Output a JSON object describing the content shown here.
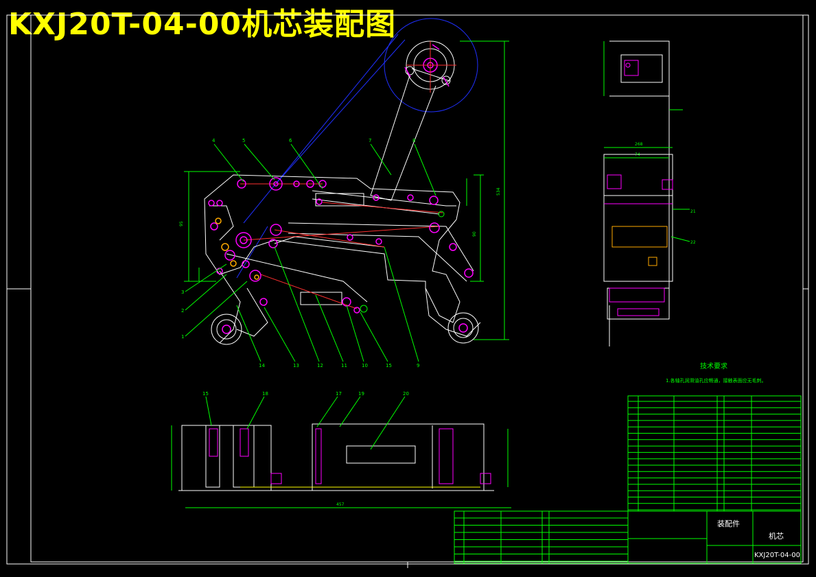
{
  "title": "KXJ20T-04-00机芯装配图",
  "colors": {
    "background": "#000000",
    "frame": "#ffffff",
    "dimension": "#00ff00",
    "part_outline": "#ffffff",
    "bolt": "#ff00ff",
    "centerline": "#ff0000",
    "guide": "#0000ff",
    "title_text": "#ffff00"
  },
  "balloons": [
    "4",
    "5",
    "6",
    "7",
    "8",
    "3",
    "2",
    "1",
    "14",
    "13",
    "12",
    "11",
    "10",
    "15",
    "9",
    "15",
    "18",
    "17",
    "19",
    "20",
    "21",
    "22"
  ],
  "tech_requirements": {
    "heading": "技术要求",
    "line1": "1.各轴孔润滑油孔应畅通，接触表面应无毛刺。"
  },
  "title_block": {
    "assembly_label": "装配件",
    "part_name": "机芯",
    "drawing_number": "KXJ20T-04-00"
  }
}
